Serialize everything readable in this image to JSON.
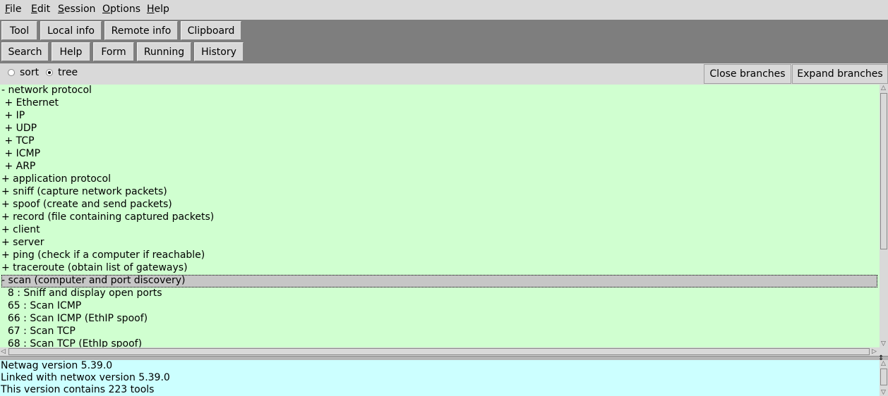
{
  "menu": [
    {
      "underline": "F",
      "rest": "ile"
    },
    {
      "underline": "E",
      "rest": "dit"
    },
    {
      "underline": "S",
      "rest": "ession"
    },
    {
      "underline": "O",
      "rest": "ptions"
    },
    {
      "underline": "H",
      "rest": "elp"
    }
  ],
  "toolbar_row1": [
    "Tool",
    "Local info",
    "Remote info",
    "Clipboard"
  ],
  "toolbar_row2": [
    "Search",
    "Help",
    "Form",
    "Running",
    "History"
  ],
  "view_options": {
    "sort_label": "sort",
    "tree_label": "tree",
    "selected": "tree",
    "close_branches": "Close branches",
    "expand_branches": "Expand branches"
  },
  "tree": [
    {
      "text": "- network protocol"
    },
    {
      "text": " + Ethernet"
    },
    {
      "text": " + IP"
    },
    {
      "text": " + UDP"
    },
    {
      "text": " + TCP"
    },
    {
      "text": " + ICMP"
    },
    {
      "text": " + ARP"
    },
    {
      "text": "+ application protocol"
    },
    {
      "text": "+ sniff (capture network packets)"
    },
    {
      "text": "+ spoof (create and send packets)"
    },
    {
      "text": "+ record (file containing captured packets)"
    },
    {
      "text": "+ client"
    },
    {
      "text": "+ server"
    },
    {
      "text": "+ ping (check if a computer if reachable)"
    },
    {
      "text": "+ traceroute (obtain list of gateways)"
    },
    {
      "text": "- scan (computer and port discovery)",
      "selected": true
    },
    {
      "text": "  8 : Sniff and display open ports"
    },
    {
      "text": "  65 : Scan ICMP"
    },
    {
      "text": "  66 : Scan ICMP (EthIP spoof)"
    },
    {
      "text": "  67 : Scan TCP"
    },
    {
      "text": "  68 : Scan TCP (EthIp spoof)"
    }
  ],
  "log": [
    "Netwag version 5.39.0",
    "Linked with netwox version 5.39.0",
    "This version contains 223 tools"
  ],
  "colors": {
    "tree_bg": "#d0ffd0",
    "log_bg": "#ccffff",
    "toolbar_bg": "#7e7e7e"
  }
}
